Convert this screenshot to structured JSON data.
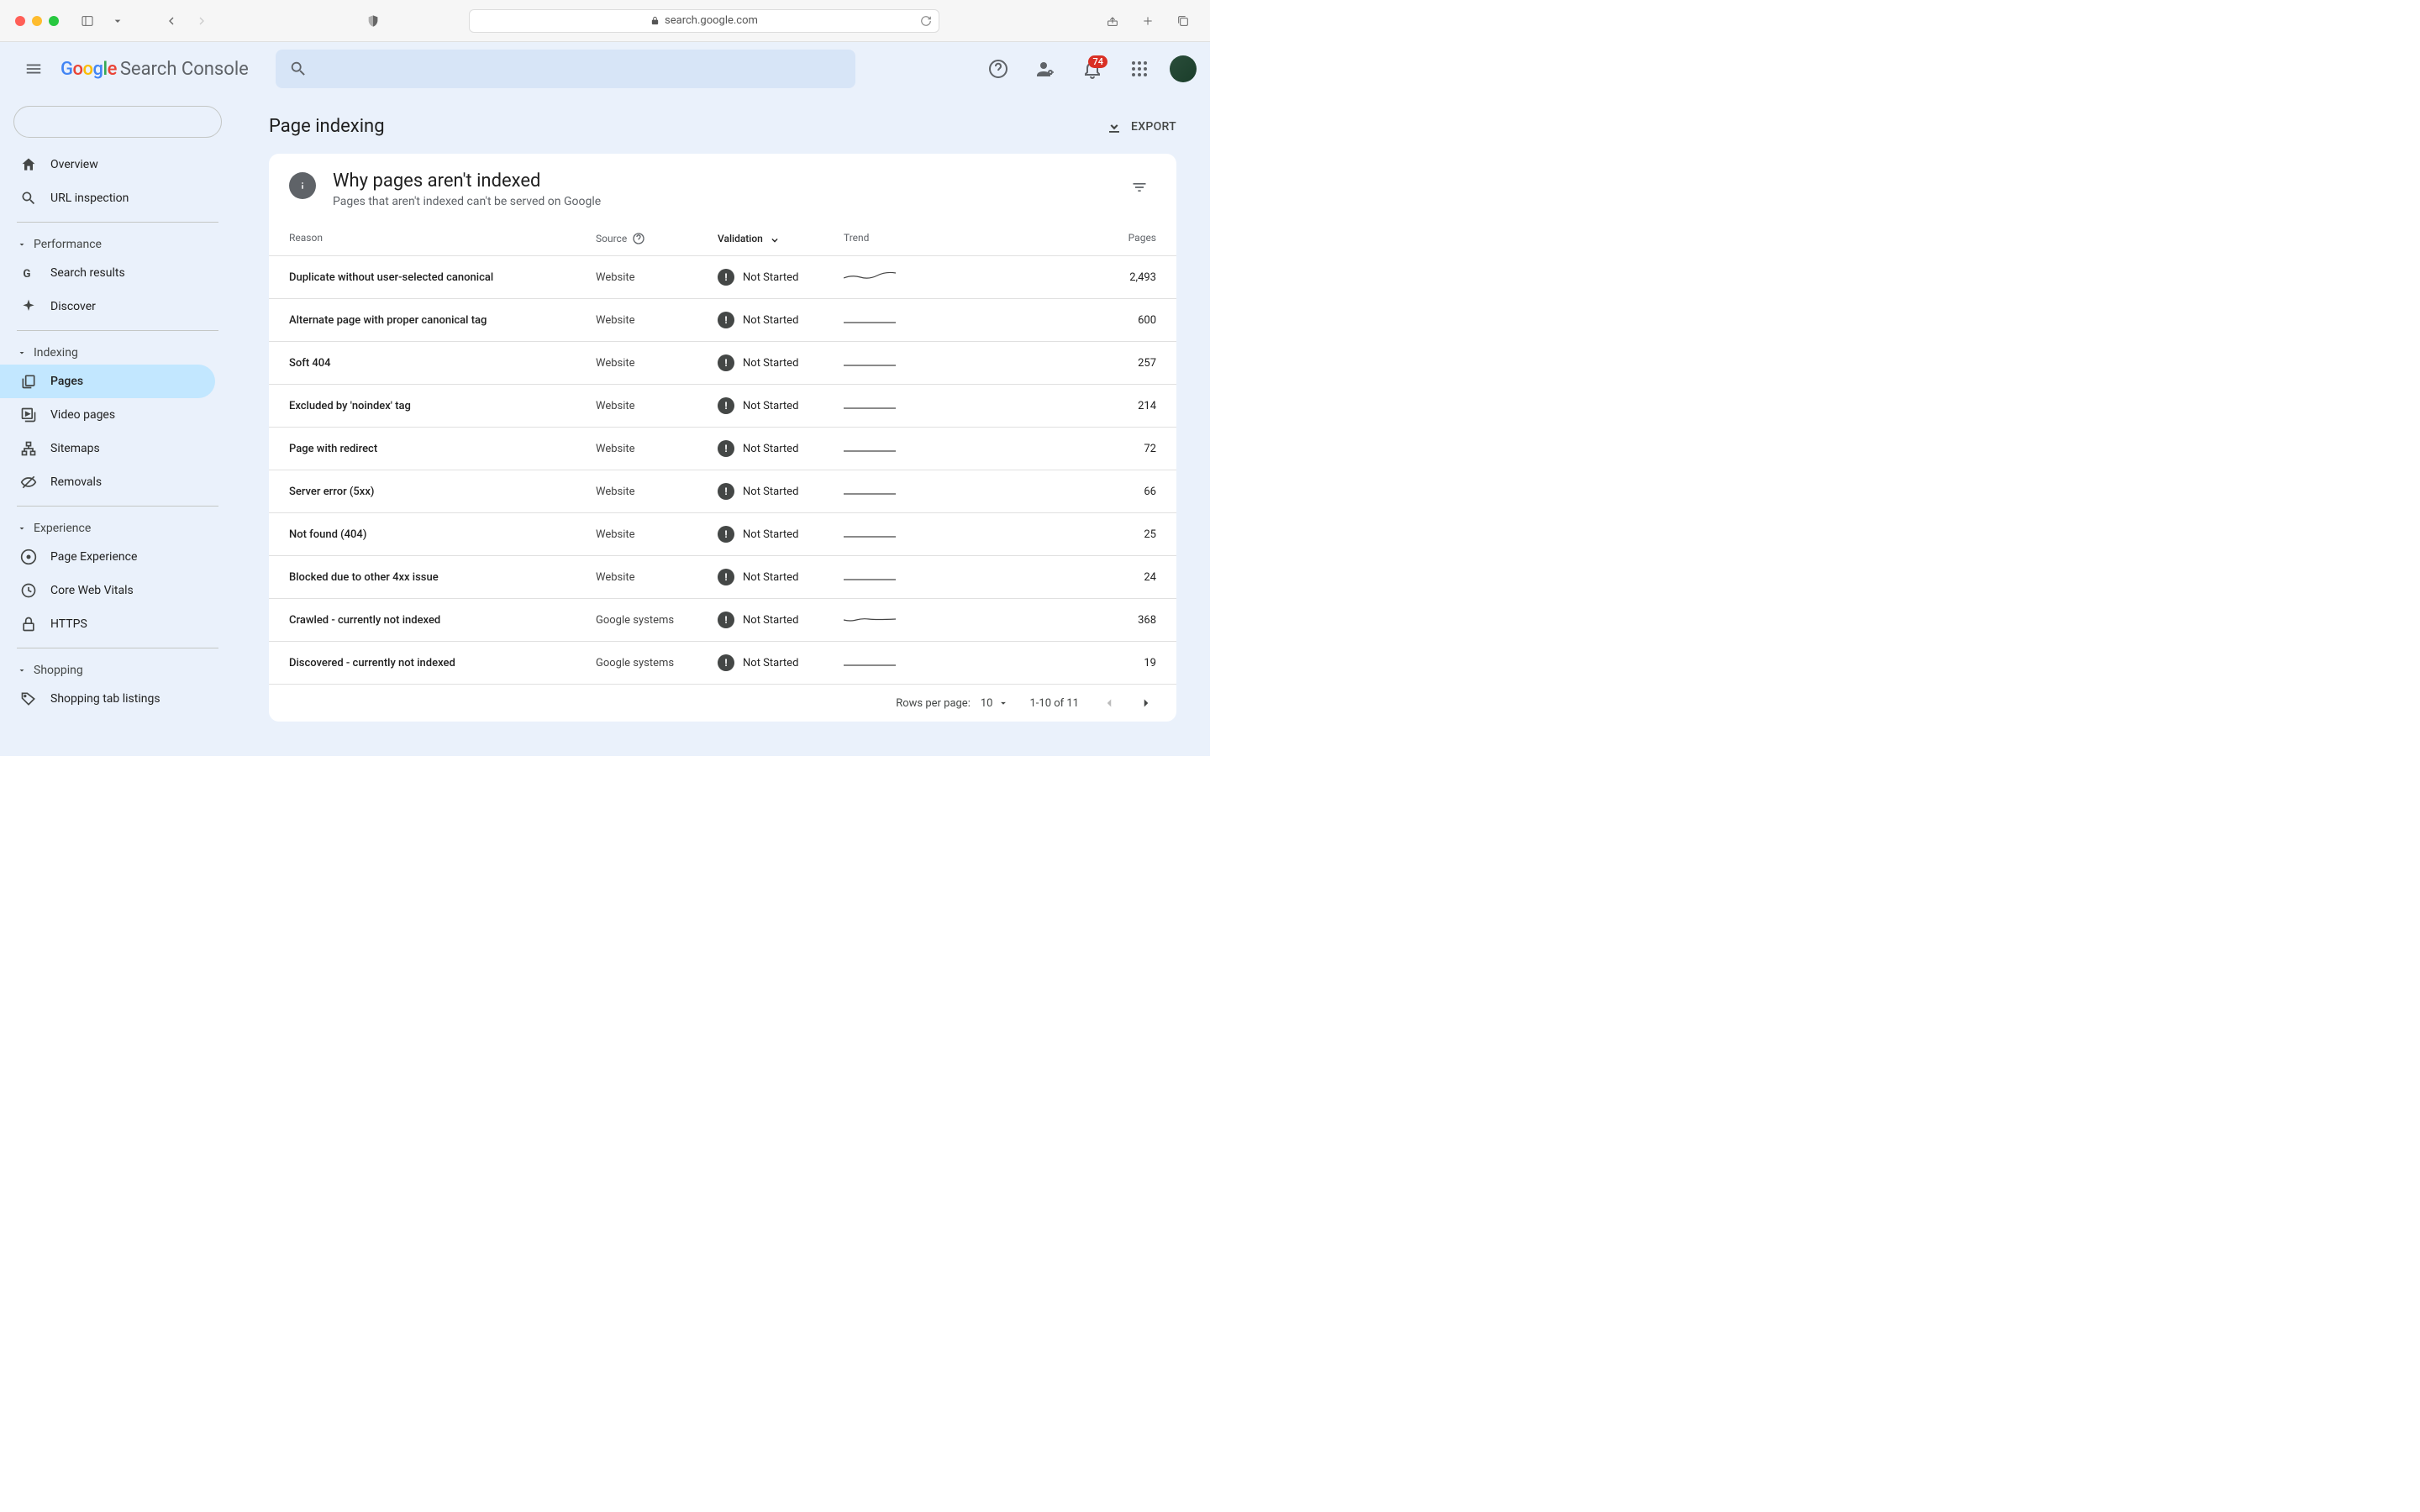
{
  "browser": {
    "url": "search.google.com"
  },
  "header": {
    "product_name": "Search Console",
    "notif_count": "74"
  },
  "page": {
    "title": "Page indexing",
    "export_label": "EXPORT"
  },
  "card": {
    "title": "Why pages aren't indexed",
    "subtitle": "Pages that aren't indexed can't be served on Google"
  },
  "sidebar": {
    "items": [
      {
        "label": "Overview"
      },
      {
        "label": "URL inspection"
      }
    ],
    "sections": [
      {
        "label": "Performance",
        "items": [
          {
            "label": "Search results"
          },
          {
            "label": "Discover"
          }
        ]
      },
      {
        "label": "Indexing",
        "items": [
          {
            "label": "Pages"
          },
          {
            "label": "Video pages"
          },
          {
            "label": "Sitemaps"
          },
          {
            "label": "Removals"
          }
        ]
      },
      {
        "label": "Experience",
        "items": [
          {
            "label": "Page Experience"
          },
          {
            "label": "Core Web Vitals"
          },
          {
            "label": "HTTPS"
          }
        ]
      },
      {
        "label": "Shopping",
        "items": [
          {
            "label": "Shopping tab listings"
          }
        ]
      }
    ]
  },
  "table": {
    "headers": {
      "reason": "Reason",
      "source": "Source",
      "validation": "Validation",
      "trend": "Trend",
      "pages": "Pages"
    },
    "rows": [
      {
        "reason": "Duplicate without user-selected canonical",
        "source": "Website",
        "validation": "Not Started",
        "pages": "2,493",
        "trend": "wavy"
      },
      {
        "reason": "Alternate page with proper canonical tag",
        "source": "Website",
        "validation": "Not Started",
        "pages": "600",
        "trend": "flat"
      },
      {
        "reason": "Soft 404",
        "source": "Website",
        "validation": "Not Started",
        "pages": "257",
        "trend": "flat"
      },
      {
        "reason": "Excluded by 'noindex' tag",
        "source": "Website",
        "validation": "Not Started",
        "pages": "214",
        "trend": "flat"
      },
      {
        "reason": "Page with redirect",
        "source": "Website",
        "validation": "Not Started",
        "pages": "72",
        "trend": "flat"
      },
      {
        "reason": "Server error (5xx)",
        "source": "Website",
        "validation": "Not Started",
        "pages": "66",
        "trend": "flat"
      },
      {
        "reason": "Not found (404)",
        "source": "Website",
        "validation": "Not Started",
        "pages": "25",
        "trend": "flat"
      },
      {
        "reason": "Blocked due to other 4xx issue",
        "source": "Website",
        "validation": "Not Started",
        "pages": "24",
        "trend": "flat"
      },
      {
        "reason": "Crawled - currently not indexed",
        "source": "Google systems",
        "validation": "Not Started",
        "pages": "368",
        "trend": "wavy2"
      },
      {
        "reason": "Discovered - currently not indexed",
        "source": "Google systems",
        "validation": "Not Started",
        "pages": "19",
        "trend": "flat"
      }
    ]
  },
  "pagination": {
    "rows_label": "Rows per page:",
    "rows_value": "10",
    "range": "1-10 of 11"
  }
}
